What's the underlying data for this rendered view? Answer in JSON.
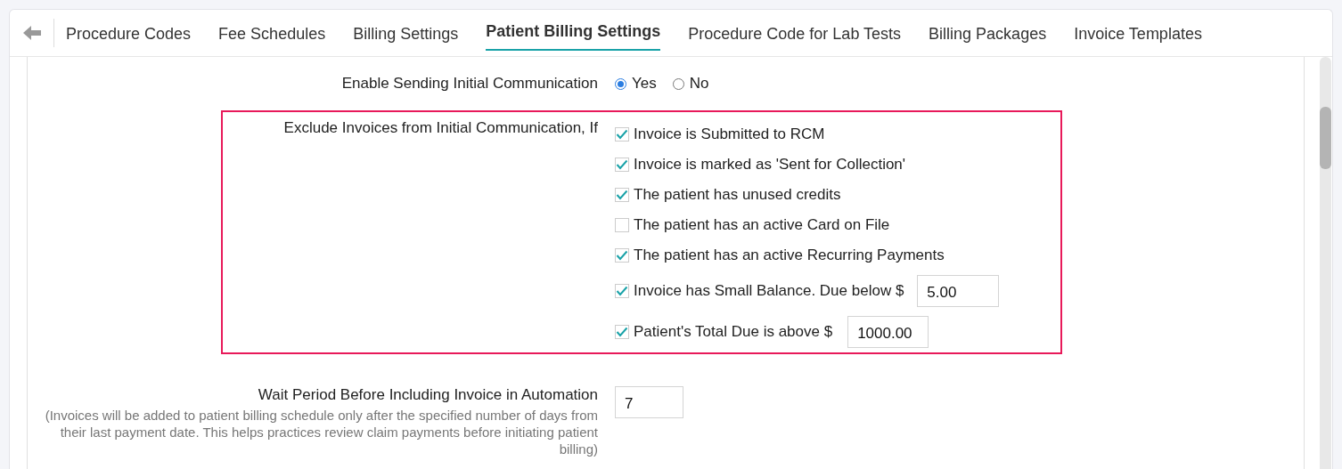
{
  "tabs": [
    {
      "label": "Procedure Codes",
      "selected": false
    },
    {
      "label": "Fee Schedules",
      "selected": false
    },
    {
      "label": "Billing Settings",
      "selected": false
    },
    {
      "label": "Patient Billing Settings",
      "selected": true
    },
    {
      "label": "Procedure Code for Lab Tests",
      "selected": false
    },
    {
      "label": "Billing Packages",
      "selected": false
    },
    {
      "label": "Invoice Templates",
      "selected": false
    }
  ],
  "settings": [
    {
      "kind": "radio",
      "label": "Enable Sending Initial Communication",
      "options": [
        {
          "label": "Yes",
          "selected": true
        },
        {
          "label": "No",
          "selected": false
        }
      ]
    },
    {
      "kind": "checklist",
      "label": "Exclude Invoices from Initial Communication, If",
      "highlighted": true,
      "items": [
        {
          "label": "Invoice is Submitted to RCM",
          "checked": true
        },
        {
          "label": "Invoice is marked as 'Sent for Collection'",
          "checked": true
        },
        {
          "label": "The patient has unused credits",
          "checked": true
        },
        {
          "label": "The patient has an active Card on File",
          "checked": false
        },
        {
          "label": "The patient has an active Recurring Payments",
          "checked": true
        },
        {
          "label": "Invoice has Small Balance. Due below $",
          "checked": true,
          "value": "5.00"
        },
        {
          "label": "Patient's Total Due is above $",
          "checked": true,
          "value": "1000.00"
        }
      ]
    },
    {
      "kind": "number",
      "label": "Wait Period Before Including Invoice in Automation",
      "note": "(Invoices will be added to patient billing schedule only after the specified number of days from their last payment date. This helps practices review claim payments before initiating patient billing)",
      "value": "7"
    }
  ]
}
